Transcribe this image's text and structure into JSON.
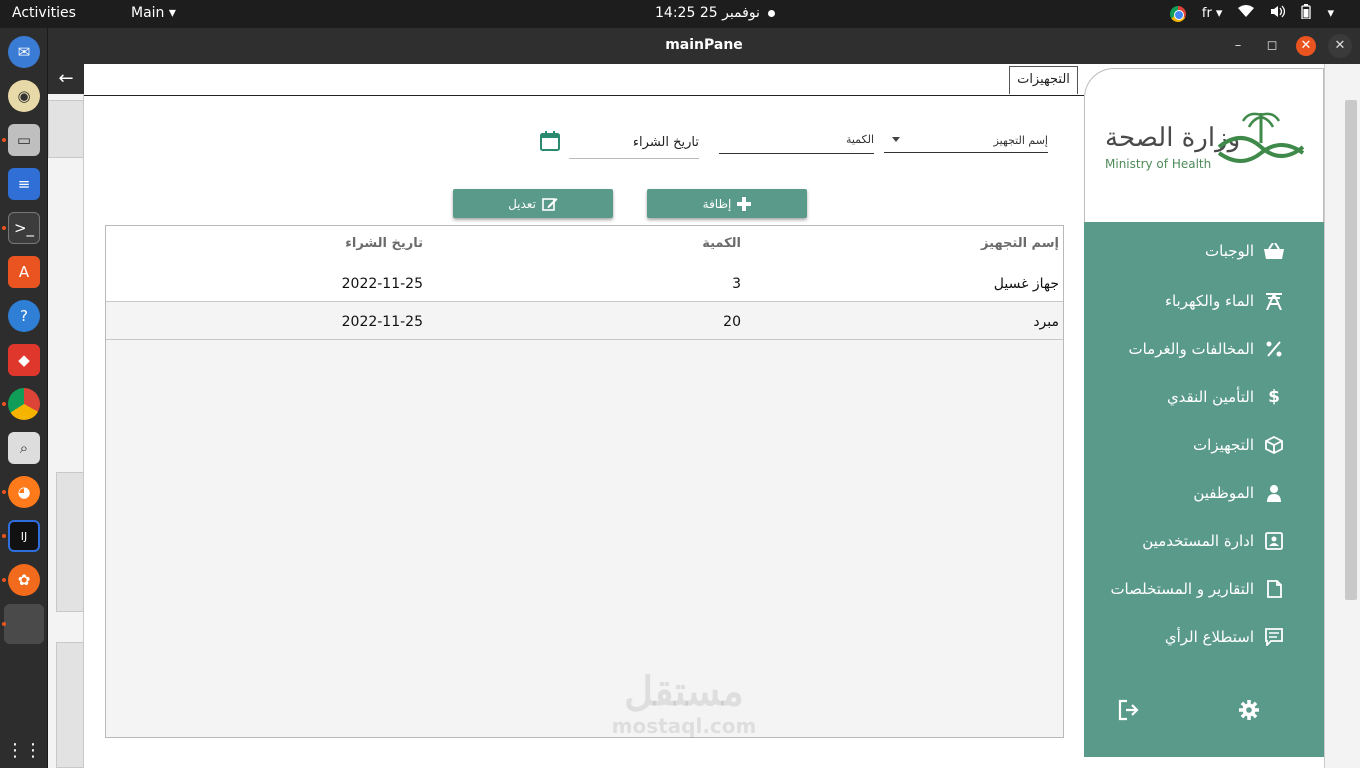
{
  "system": {
    "activities": "Activities",
    "app_menu": "Main",
    "datetime": "نوفمبر 25  14:25",
    "language": "fr"
  },
  "window": {
    "title": "mainPane"
  },
  "tab": {
    "label": "التجهيزات"
  },
  "logo": {
    "arabic": "وزارة الصحة",
    "english": "Ministry of Health"
  },
  "sidebar": {
    "items": [
      {
        "label": "الوجبات",
        "icon": "basket-icon"
      },
      {
        "label": "الماء والكهرباء",
        "icon": "tower-icon"
      },
      {
        "label": "المخالفات والغرمات",
        "icon": "percent-icon"
      },
      {
        "label": "التأمين النقدي",
        "icon": "dollar-icon"
      },
      {
        "label": "التجهيزات",
        "icon": "box-icon"
      },
      {
        "label": "الموظفين",
        "icon": "employee-icon"
      },
      {
        "label": "ادارة المستخدمين",
        "icon": "user-card-icon"
      },
      {
        "label": "التقارير و المستخلصات",
        "icon": "file-icon"
      },
      {
        "label": "استطلاع الرأي",
        "icon": "comment-icon"
      }
    ],
    "logout_icon": "logout-icon",
    "settings_icon": "gear-icon"
  },
  "form": {
    "equipment_label": "إسم التجهيز",
    "quantity_label": "الكمية",
    "date_placeholder": "تاريخ الشراء",
    "add_label": "إظافة",
    "edit_label": "تعديل"
  },
  "table": {
    "columns": [
      "إسم التجهيز",
      "الكمية",
      "تاريخ الشراء"
    ],
    "rows": [
      [
        "جهاز غسيل",
        "3",
        "2022-11-25"
      ],
      [
        "مبرد",
        "20",
        "2022-11-25"
      ]
    ]
  },
  "watermark": {
    "arabic": "مستقل",
    "english": "mostaql.com"
  },
  "colors": {
    "accent": "#5a9a8a",
    "ubuntu_orange": "#e95420"
  }
}
